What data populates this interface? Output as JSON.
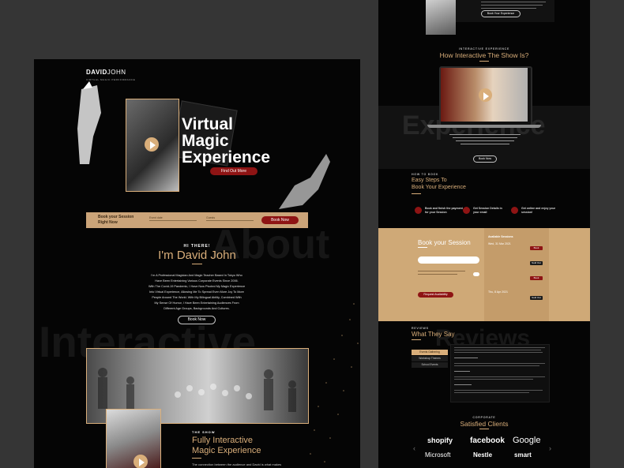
{
  "left": {
    "logo": {
      "name_a": "DAVID",
      "name_b": "JOHN",
      "tagline": "VIRTUAL MAGIC PERFORMANCE"
    },
    "hero": {
      "title_l1": "Virtual",
      "title_l2": "Magic",
      "title_l3": "Experience",
      "cta": "Find Out More"
    },
    "booking": {
      "label_l1": "Book your Session",
      "label_l2": "Right Now",
      "field1": "Event date",
      "field2": "Guests",
      "button": "Book Now"
    },
    "about": {
      "eyebrow": "HI THERE!",
      "title": "I'm David John",
      "ghost": "About",
      "bio_lines": [
        "I'm A Professional Magician And Magic Teacher Based In Tokyo Who",
        "Have Been Entertaining Various Corporate Events Since 2006.",
        "With The Covid-19 Pandemic, I Have Now Pivoted My Magic Experience",
        "Into Virtual Experience, Allowing Me To Spread Even More Joy To More",
        "People Around The World. With My Bilingual Ability, Combined With",
        "My Sense Of Humor, I Have Been Entertaining Audiences From",
        "Different Age Groups, Backgrounds And Cultures."
      ],
      "button": "Book Now"
    },
    "ghost_interactive": "Interactive",
    "show": {
      "eyebrow": "THE SHOW",
      "title_l1": "Fully Interactive",
      "title_l2": "Magic Experience",
      "body": "The connection between the audience and David is what makes"
    }
  },
  "right": {
    "top": {
      "button": "Book Your Experience"
    },
    "interactive": {
      "eyebrow": "INTERACTIVE EXPERIENCE",
      "title": "How Interactive The Show Is?",
      "ghost": "Experience",
      "button": "Book Now"
    },
    "howto": {
      "eyebrow": "HOW TO BOOK",
      "title_l1": "Easy Steps To",
      "title_l2": "Book Your Experience",
      "steps": [
        {
          "label": "Book and finish the payment for your Session"
        },
        {
          "label": "Get Session Details in your email"
        },
        {
          "label": "Get online and enjoy your session!"
        }
      ]
    },
    "booking": {
      "title": "Book your Session",
      "available": "Available Sessions",
      "submit": "Request Availability",
      "days": [
        "Wed, 31 Mar 2021",
        "Thu, 8 Apr 2021"
      ],
      "book_label": "Book",
      "full_label": "Sold Out"
    },
    "reviews": {
      "eyebrow": "REVIEWS",
      "title": "What They Say",
      "ghost": "Reviews",
      "tabs": [
        "Events Gathering",
        "Workshop Themes",
        "School Events"
      ]
    },
    "clients": {
      "eyebrow": "CORPORATE",
      "title": "Satisfied Clients",
      "logos": [
        "shopify",
        "facebook",
        "Google",
        "Microsoft",
        "Nestle",
        "smart"
      ]
    }
  },
  "colors": {
    "accent": "#d9ae7a",
    "red": "#8e1414",
    "bg": "#050505",
    "canvas": "#353535"
  }
}
